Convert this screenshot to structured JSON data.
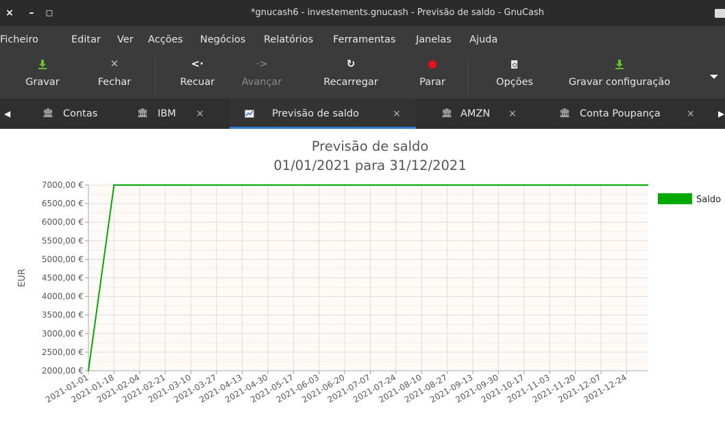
{
  "window": {
    "title": "*gnucash6 - investements.gnucash - Previsão de saldo - GnuCash",
    "controls": [
      "×",
      "–",
      "□"
    ]
  },
  "menubar": {
    "items": [
      "Ficheiro",
      "Editar",
      "Ver",
      "Acções",
      "Negócios",
      "Relatórios",
      "Ferramentas",
      "Janelas",
      "Ajuda"
    ]
  },
  "toolbar": {
    "buttons": [
      {
        "label": "Gravar",
        "icon": "save-icon",
        "enabled": true
      },
      {
        "label": "Fechar",
        "icon": "close-icon",
        "enabled": true
      },
      {
        "label": "Recuar",
        "icon": "back-icon",
        "enabled": true
      },
      {
        "label": "Avançar",
        "icon": "forward-icon",
        "enabled": false
      },
      {
        "label": "Recarregar",
        "icon": "reload-icon",
        "enabled": true
      },
      {
        "label": "Parar",
        "icon": "stop-icon",
        "enabled": true
      },
      {
        "label": "Opções",
        "icon": "options-icon",
        "enabled": true
      },
      {
        "label": "Gravar configuração",
        "icon": "save-config-icon",
        "enabled": true
      }
    ],
    "overflow_icon": "dropdown-arrow-icon"
  },
  "tabs": [
    {
      "label": "Contas",
      "icon": "bank-icon",
      "closable": false,
      "active": false
    },
    {
      "label": "IBM",
      "icon": "bank-icon",
      "closable": true,
      "active": false
    },
    {
      "label": "Previsão de saldo",
      "icon": "chart-icon",
      "closable": true,
      "active": true
    },
    {
      "label": "AMZN",
      "icon": "bank-icon",
      "closable": true,
      "active": false
    },
    {
      "label": "Conta Poupança",
      "icon": "bank-icon",
      "closable": true,
      "active": false
    }
  ],
  "tab_close_glyph": "×",
  "nav_arrows": {
    "left": "◀",
    "right": "▶"
  },
  "colors": {
    "series": "#00aa00",
    "plot_bg": "#fffaf5",
    "grid": "#dddddd",
    "active_tab_accent": "#2e7bcf",
    "stop_icon": "#e8101a",
    "save_icon": "#6abf2e"
  },
  "chart_data": {
    "type": "line",
    "title": "Previsão de saldo",
    "subtitle": "01/01/2021 para 31/12/2021",
    "xlabel": "",
    "ylabel": "EUR",
    "x": [
      "2021-01-01",
      "2021-01-18",
      "2021-02-04",
      "2021-02-21",
      "2021-03-10",
      "2021-03-27",
      "2021-04-13",
      "2021-04-30",
      "2021-05-17",
      "2021-06-03",
      "2021-06-20",
      "2021-07-07",
      "2021-07-24",
      "2021-08-10",
      "2021-08-27",
      "2021-09-13",
      "2021-09-30",
      "2021-10-17",
      "2021-11-03",
      "2021-11-20",
      "2021-12-07",
      "2021-12-24"
    ],
    "yticks": [
      "7000,00 €",
      "6500,00 €",
      "6000,00 €",
      "5500,00 €",
      "5000,00 €",
      "4500,00 €",
      "4000,00 €",
      "3500,00 €",
      "3000,00 €",
      "2500,00 €",
      "2000,00 €"
    ],
    "ylim": [
      2000,
      7000
    ],
    "grid": true,
    "legend": "right",
    "series": [
      {
        "name": "Saldo",
        "values": [
          2000,
          7000,
          7000,
          7000,
          7000,
          7000,
          7000,
          7000,
          7000,
          7000,
          7000,
          7000,
          7000,
          7000,
          7000,
          7000,
          7000,
          7000,
          7000,
          7000,
          7000,
          7000
        ]
      }
    ]
  }
}
